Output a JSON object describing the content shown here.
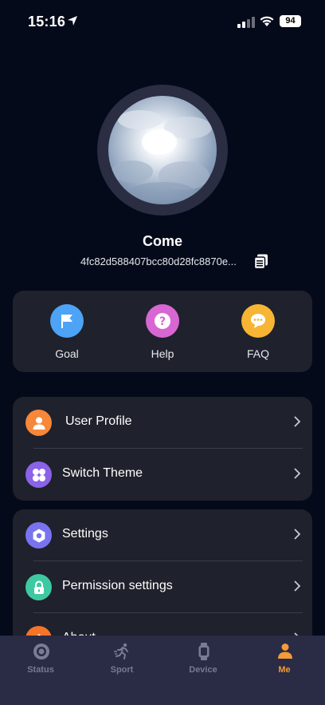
{
  "status_bar": {
    "time": "15:16",
    "battery": "94"
  },
  "profile": {
    "name": "Come",
    "id": "4fc82d588407bcc80d28fc8870e..."
  },
  "quick_actions": [
    {
      "label": "Goal",
      "icon": "flag-icon",
      "color": "#4da3f5"
    },
    {
      "label": "Help",
      "icon": "question-icon",
      "color": "#d866d3"
    },
    {
      "label": "FAQ",
      "icon": "chat-icon",
      "color": "#f7b533"
    }
  ],
  "menu_group_1": [
    {
      "label": "User Profile",
      "icon": "user-icon",
      "color": "#f7873a"
    },
    {
      "label": "Switch Theme",
      "icon": "theme-icon",
      "color": "#8a63e8"
    }
  ],
  "menu_group_2": [
    {
      "label": "Settings",
      "icon": "gear-icon",
      "color": "#7a73f0"
    },
    {
      "label": "Permission settings",
      "icon": "lock-icon",
      "color": "#3ec9a2"
    },
    {
      "label": "About",
      "icon": "info-icon",
      "color": "#f5742a"
    }
  ],
  "tabs": [
    {
      "label": "Status",
      "icon": "status-icon",
      "active": false
    },
    {
      "label": "Sport",
      "icon": "running-icon",
      "active": false
    },
    {
      "label": "Device",
      "icon": "watch-icon",
      "active": false
    },
    {
      "label": "Me",
      "icon": "person-icon",
      "active": true
    }
  ],
  "colors": {
    "background": "#050a1a",
    "card": "#1f212c",
    "tab_bar": "#2a2b45",
    "accent": "#f39a3a"
  }
}
